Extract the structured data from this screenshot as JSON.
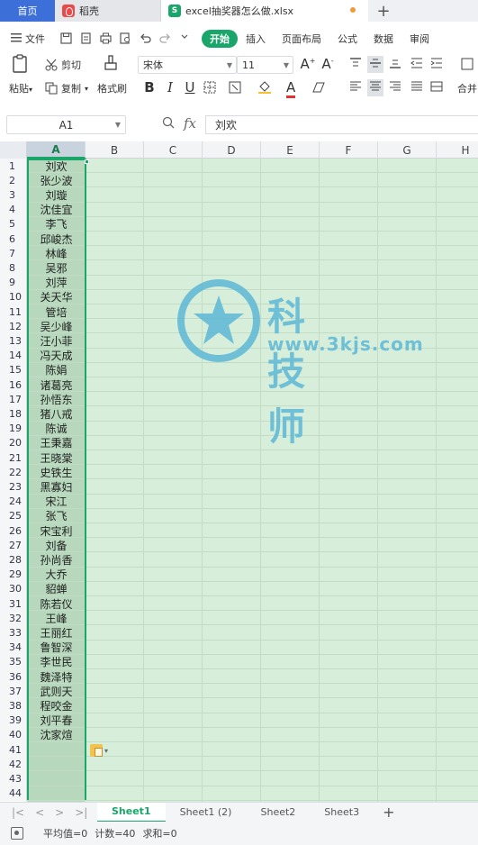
{
  "tabs": {
    "home": "首页",
    "doke": "稻壳",
    "file": "excel抽奖器怎么做.xlsx",
    "add": "+"
  },
  "menu": {
    "file_label": "文件",
    "tabs": [
      "开始",
      "插入",
      "页面布局",
      "公式",
      "数据",
      "审阅"
    ],
    "active_tab": "开始"
  },
  "ribbon": {
    "paste": "粘贴",
    "cut": "剪切",
    "copy": "复制",
    "format_painter": "格式刷",
    "font_name": "宋体",
    "font_size": "11",
    "merge": "合并"
  },
  "formula_bar": {
    "cell_ref": "A1",
    "fx": "fx",
    "value": "刘欢"
  },
  "columns": [
    "A",
    "B",
    "C",
    "D",
    "E",
    "F",
    "G",
    "H"
  ],
  "rows": [
    "1",
    "2",
    "3",
    "4",
    "5",
    "6",
    "7",
    "8",
    "9",
    "10",
    "11",
    "12",
    "13",
    "14",
    "15",
    "16",
    "17",
    "18",
    "19",
    "20",
    "21",
    "22",
    "23",
    "24",
    "25",
    "26",
    "27",
    "28",
    "29",
    "30",
    "31",
    "32",
    "33",
    "34",
    "35",
    "36",
    "37",
    "38",
    "39",
    "40",
    "41",
    "42",
    "43",
    "44"
  ],
  "colA_values": [
    "刘欢",
    "张少波",
    "刘璇",
    "沈佳宜",
    "李飞",
    "邱峻杰",
    "林峰",
    "吴邪",
    "刘萍",
    "关天华",
    "管培",
    "吴少峰",
    "汪小菲",
    "冯天成",
    "陈娟",
    "诸葛亮",
    "孙悟东",
    "猪八戒",
    "陈诚",
    "王秉嘉",
    "王晓棠",
    "史铁生",
    "黑寡妇",
    "宋江",
    "张飞",
    "宋宝利",
    "刘备",
    "孙尚香",
    "大乔",
    "貂蝉",
    "陈若仪",
    "王峰",
    "王丽红",
    "鲁智深",
    "李世民",
    "魏泽特",
    "武则天",
    "程咬金",
    "刘平春",
    "沈家煊"
  ],
  "watermark": {
    "text": "科技师",
    "url": "www.3kjs.com"
  },
  "sheets": [
    "Sheet1",
    "Sheet1 (2)",
    "Sheet2",
    "Sheet3"
  ],
  "active_sheet": "Sheet1",
  "status": {
    "average": "平均值=0",
    "count": "计数=40",
    "sum": "求和=0"
  },
  "colors": {
    "accent": "#1aa56a",
    "home_tab": "#3d6fd8",
    "selection": "#d7eedb"
  }
}
